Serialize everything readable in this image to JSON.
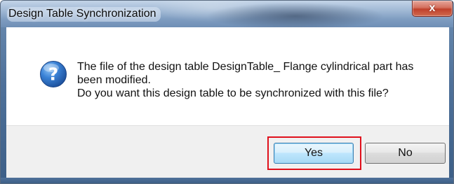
{
  "dialog": {
    "title": "Design Table Synchronization",
    "close_label": "x",
    "icon": "question-icon",
    "message_lines": [
      "The file of the design table DesignTable_ Flange cylindrical part has",
      "been modified.",
      "Do you want this design table to be synchronized with this file?"
    ],
    "buttons": {
      "yes": "Yes",
      "no": "No"
    }
  },
  "colors": {
    "highlight_border": "#e0101c",
    "icon_blue": "#1c5fb0"
  }
}
